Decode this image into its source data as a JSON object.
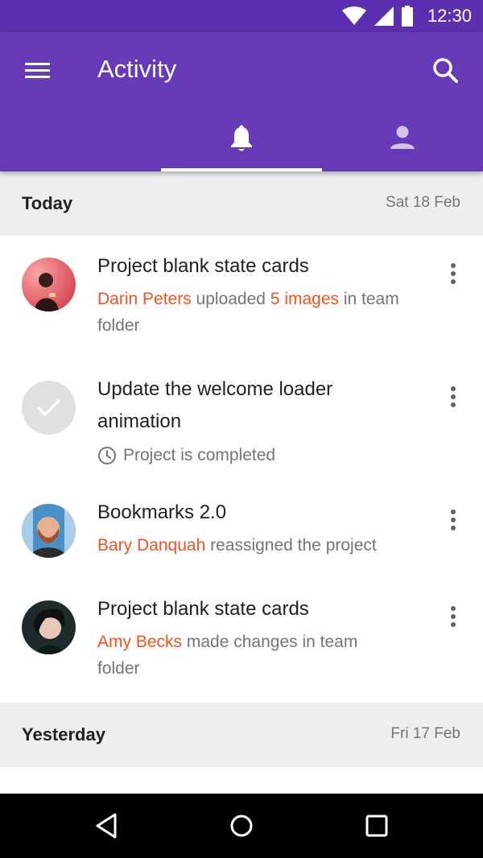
{
  "status_bar": {
    "time": "12:30"
  },
  "app_bar": {
    "title": "Activity",
    "tabs": [
      {
        "icon": "bell-icon",
        "selected": true
      },
      {
        "icon": "person-icon",
        "selected": false
      }
    ]
  },
  "sections": [
    {
      "title": "Today",
      "date": "Sat 18 Feb",
      "items": [
        {
          "title": "Project blank state cards",
          "desc_person": "Darin Peters",
          "desc_action": " uploaded ",
          "desc_object": "5 images",
          "desc_rest": " in team folder"
        },
        {
          "title": "Update the welcome loader animation",
          "status": "Project is completed"
        },
        {
          "title": "Bookmarks 2.0",
          "desc_person": "Bary Danquah",
          "desc_rest": " reassigned the project"
        },
        {
          "title": "Project blank state cards",
          "desc_person": "Amy Becks",
          "desc_rest": " made changes in team folder"
        }
      ]
    },
    {
      "title": "Yesterday",
      "date": "Fri 17 Feb",
      "items": []
    }
  ],
  "colors": {
    "primary": "#673ab7",
    "primary_dark": "#5c2fb0",
    "accent_text": "#f4511e",
    "section_bg": "#eeeeee"
  }
}
